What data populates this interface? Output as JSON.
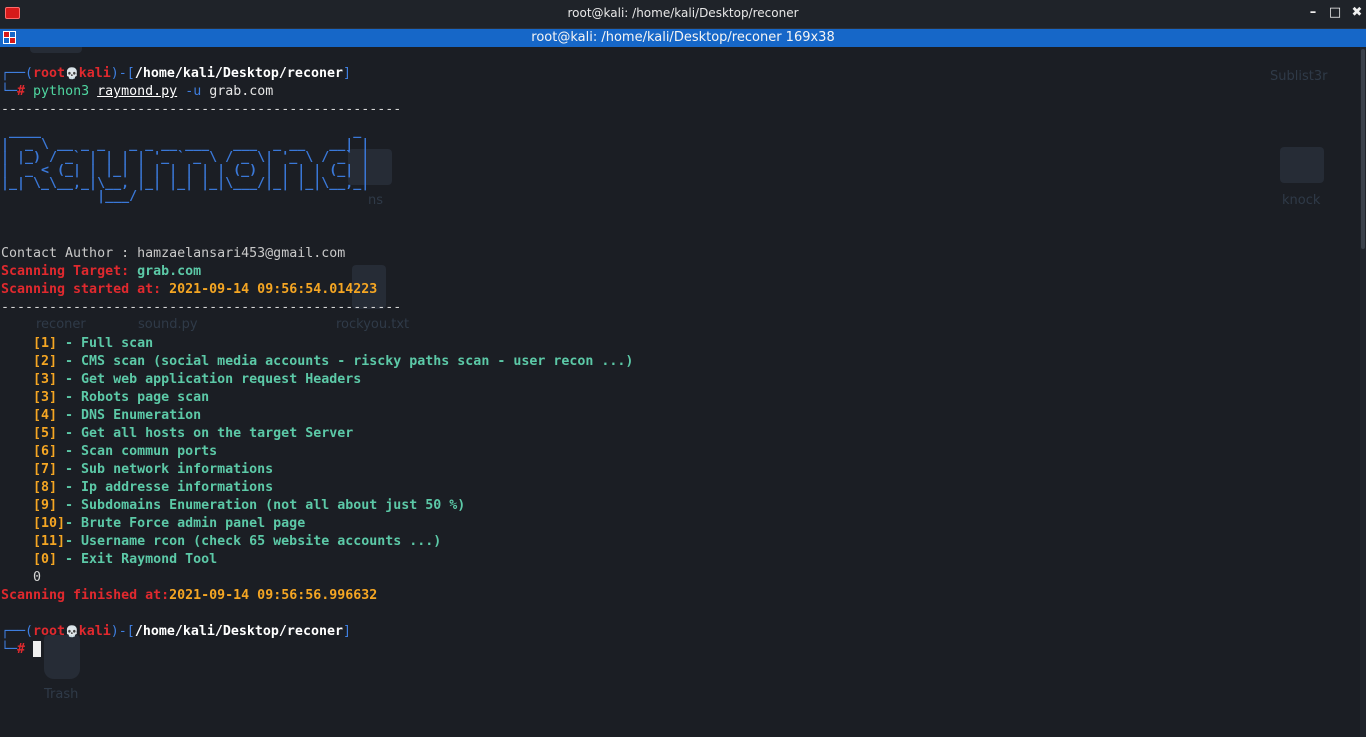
{
  "window": {
    "title": "root@kali: /home/kali/Desktop/reconer",
    "tab_title": "root@kali: /home/kali/Desktop/reconer 169x38",
    "minimize_glyph": "–",
    "maximize_glyph": "□",
    "close_glyph": "✖"
  },
  "prompt": {
    "corner_top": "┌──(",
    "user": "root",
    "skull": "💀",
    "host": "kali",
    "mid": ")-[",
    "path": "/home/kali/Desktop/reconer",
    "end": "]",
    "corner_bottom": "└─",
    "hash": "#"
  },
  "command": {
    "interpreter": "python3",
    "script": "raymond.py",
    "flag": "-u",
    "target": "grab.com"
  },
  "separator": "--------------------------------------------------",
  "banner_art": " ____                                       _\n|  _ \\ __ _ _   _ _ __ ___   ___  _ __   __| |\n| |_) / _` | | | | '_ ` _ \\ / _ \\| '_ \\ / _` |\n|  _ < (_| | |_| | | | | | | (_) | | | | (_| |\n|_| \\_\\__,_|\\__, |_| |_| |_|\\___/|_| |_|\\__,_|\n            |___/",
  "info": {
    "author_label": "Contact Author : ",
    "author_email": "hamzaelansari453@gmail.com",
    "target_label": "Scanning Target: ",
    "target_value": "grab.com",
    "started_label": "Scanning started at: ",
    "started_value": "2021-09-14 09:56:54.014223"
  },
  "menu": [
    {
      "key": "[1]",
      "label": " - Full scan"
    },
    {
      "key": "[2]",
      "label": " - CMS scan (social media accounts - riscky paths scan - user recon ...)"
    },
    {
      "key": "[3]",
      "label": " - Get web application request Headers"
    },
    {
      "key": "[3]",
      "label": " - Robots page scan"
    },
    {
      "key": "[4]",
      "label": " - DNS Enumeration"
    },
    {
      "key": "[5]",
      "label": " - Get all hosts on the target Server"
    },
    {
      "key": "[6]",
      "label": " - Scan commun ports"
    },
    {
      "key": "[7]",
      "label": " - Sub network informations"
    },
    {
      "key": "[8]",
      "label": " - Ip addresse informations"
    },
    {
      "key": "[9]",
      "label": " - Subdomains Enumeration (not all about just 50 %)"
    },
    {
      "key": "[10]",
      "label": "- Brute Force admin panel page"
    },
    {
      "key": "[11]",
      "label": "- Username rcon (check 65 website accounts ...)"
    },
    {
      "key": "[0]",
      "label": " - Exit Raymond Tool"
    }
  ],
  "user_input": "0",
  "finished": {
    "label": "Scanning finished at:",
    "value": "2021-09-14 09:56:56.996632"
  },
  "desktop_ghosts": {
    "sublist3r": "Sublist3r",
    "ns": "ns",
    "knock": "knock",
    "reconer": "reconer",
    "sound": "sound.py",
    "rockyou": "rockyou.txt",
    "trash": "Trash"
  }
}
